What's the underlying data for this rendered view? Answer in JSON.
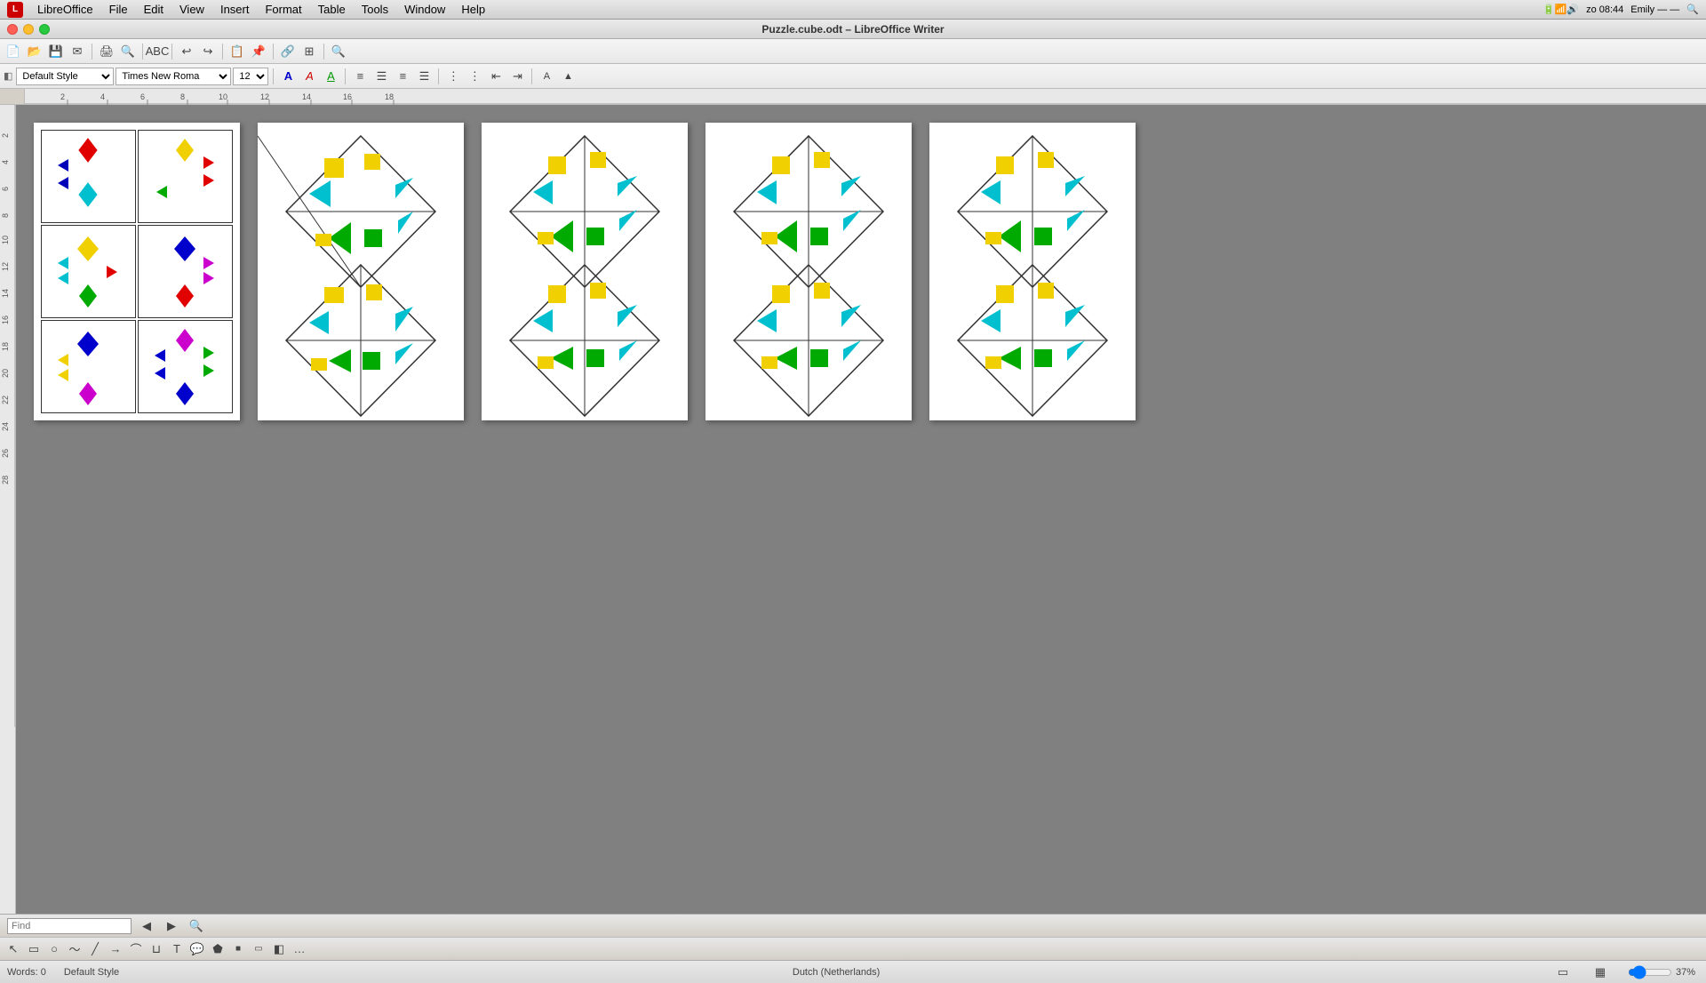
{
  "menubar": {
    "app_name": "LibreOffice",
    "menus": [
      "LibreOffice",
      "File",
      "Edit",
      "View",
      "Insert",
      "Format",
      "Table",
      "Tools",
      "Window",
      "Help"
    ],
    "right": {
      "time": "zo 08:44",
      "user": "Emily — —"
    }
  },
  "window": {
    "title": "Puzzle.cube.odt – LibreOffice Writer"
  },
  "toolbar2": {
    "style_value": "Default Style",
    "font_value": "Times New Roma",
    "size_value": "12"
  },
  "ruler": {
    "marks": [
      "2",
      "4",
      "6",
      "8",
      "10",
      "12",
      "14",
      "16",
      "18"
    ]
  },
  "statusbar": {
    "words": "Words: 0",
    "style": "Default Style",
    "language": "Dutch (Netherlands)",
    "zoom": "37%"
  },
  "findbar": {
    "label": "Find",
    "placeholder": ""
  },
  "colors": {
    "red": "#e00000",
    "yellow": "#f0d000",
    "cyan": "#00c0d0",
    "blue": "#0000c0",
    "green": "#00b000",
    "magenta": "#d000d0",
    "dark_green": "#006000"
  }
}
